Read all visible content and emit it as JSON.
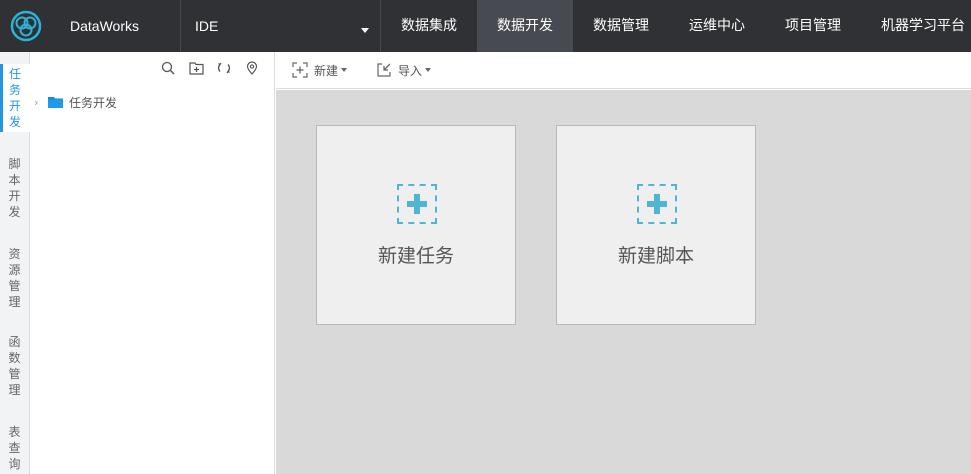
{
  "topbar": {
    "brand": "DataWorks",
    "env": "IDE",
    "nav": [
      {
        "label": "数据集成",
        "active": false
      },
      {
        "label": "数据开发",
        "active": true
      },
      {
        "label": "数据管理",
        "active": false
      },
      {
        "label": "运维中心",
        "active": false
      },
      {
        "label": "项目管理",
        "active": false
      },
      {
        "label": "机器学习平台",
        "active": false
      }
    ]
  },
  "vtabs": [
    {
      "label": "任务开发",
      "active": true
    },
    {
      "label": "脚本开发",
      "active": false
    },
    {
      "label": "资源管理",
      "active": false
    },
    {
      "label": "函数管理",
      "active": false
    },
    {
      "label": "表查询",
      "active": false
    }
  ],
  "tree": {
    "tools": [
      "search-icon",
      "new-folder-icon",
      "refresh-icon",
      "locate-icon"
    ],
    "root_label": "任务开发"
  },
  "toolbar": {
    "new_label": "新建",
    "import_label": "导入"
  },
  "cards": [
    {
      "label": "新建任务"
    },
    {
      "label": "新建脚本"
    }
  ],
  "colors": {
    "topbar": "#2f3135",
    "accent": "#2595e8",
    "plus": "#4fb5d3",
    "folder": "#1b8bd6"
  }
}
